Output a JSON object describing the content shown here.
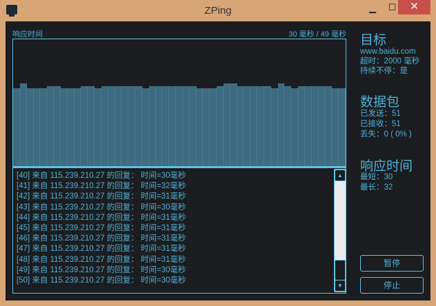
{
  "window": {
    "title": "ZPing",
    "minimize": "▁",
    "maximize": "☐",
    "close": "✕"
  },
  "chart": {
    "label": "响应时间",
    "range": "30 毫秒 / 49 毫秒"
  },
  "chart_data": {
    "type": "bar",
    "ylim": [
      0,
      49
    ],
    "ylabel": "响应时间",
    "values": [
      30,
      32,
      30,
      30,
      30,
      31,
      31,
      30,
      30,
      30,
      31,
      31,
      30,
      31,
      31,
      31,
      31,
      31,
      31,
      30,
      31,
      31,
      31,
      31,
      31,
      31,
      31,
      30,
      30,
      30,
      31,
      32,
      32,
      31,
      31,
      31,
      31,
      31,
      30,
      32,
      31,
      30,
      31,
      31,
      31,
      31,
      31,
      30,
      30
    ]
  },
  "log": [
    "[40] 来自 115.239.210.27 的回复： 时间=30毫秒",
    "[41] 来自 115.239.210.27 的回复： 时间=32毫秒",
    "[42] 来自 115.239.210.27 的回复： 时间=31毫秒",
    "[43] 来自 115.239.210.27 的回复： 时间=30毫秒",
    "[44] 来自 115.239.210.27 的回复： 时间=31毫秒",
    "[45] 来自 115.239.210.27 的回复： 时间=31毫秒",
    "[46] 来自 115.239.210.27 的回复： 时间=31毫秒",
    "[47] 来自 115.239.210.27 的回复： 时间=31毫秒",
    "[48] 来自 115.239.210.27 的回复： 时间=31毫秒",
    "[49] 来自 115.239.210.27 的回复： 时间=30毫秒",
    "[50] 来自 115.239.210.27 的回复： 时间=30毫秒"
  ],
  "target": {
    "heading": "目标",
    "host": "www.baidu.com",
    "timeout": "超时：2000 毫秒",
    "continuous": "持续不停：是"
  },
  "packets": {
    "heading": "数据包",
    "sent": "已发送：51",
    "received": "已接收：51",
    "lost": "丢失：0 ( 0% )"
  },
  "response": {
    "heading": "响应时间",
    "min": "最短：30",
    "max": "最长：32"
  },
  "buttons": {
    "pause": "暂停",
    "stop": "停止"
  }
}
